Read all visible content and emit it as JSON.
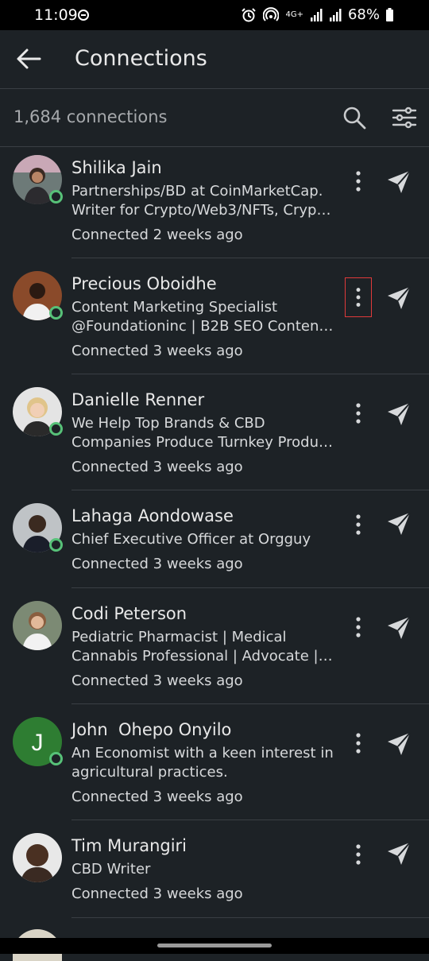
{
  "status": {
    "time": "11:09",
    "battery": "68%",
    "network": "4G+"
  },
  "header": {
    "title": "Connections"
  },
  "toolbar": {
    "count": "1,684 connections"
  },
  "connections": [
    {
      "name": "Shilika Jain",
      "line1": "Partnerships/BD at CoinMarketCap.",
      "line2": "Writer for Crypto/Web3/NFTs, Crypt…",
      "connected": "Connected 2 weeks ago",
      "online": true
    },
    {
      "name": "Precious Oboidhe",
      "line1": "Content Marketing Specialist",
      "line2": "@Foundationinc | B2B SEO Content …",
      "connected": "Connected 3 weeks ago",
      "online": true
    },
    {
      "name": "Danielle Renner",
      "line1": "We Help Top Brands & CBD",
      "line2": "Companies Produce Turnkey Produc…",
      "connected": "Connected 3 weeks ago",
      "online": true
    },
    {
      "name": "Lahaga Aondowase",
      "line1": "Chief Executive Officer at Orgguy",
      "line2": "",
      "connected": "Connected 3 weeks ago",
      "online": true
    },
    {
      "name": "Codi Peterson",
      "line1": "Pediatric Pharmacist | Medical",
      "line2": "Cannabis Professional | Advocate | E…",
      "connected": "Connected 3 weeks ago",
      "online": true
    },
    {
      "name": "John  Ohepo Onyilo",
      "line1": "An Economist with a keen interest in",
      "line2": "agricultural practices.",
      "connected": "Connected 3 weeks ago",
      "online": true,
      "initial": "J"
    },
    {
      "name": "Tim Murangiri",
      "line1": "CBD Writer",
      "line2": "",
      "connected": "Connected 3 weeks ago",
      "online": false
    }
  ],
  "colors": {
    "background": "#1d2226",
    "presence": "#57c178",
    "focus_outline": "#e03a3a"
  }
}
